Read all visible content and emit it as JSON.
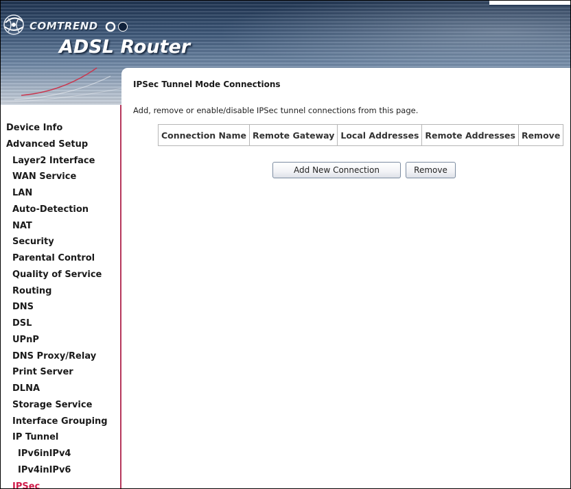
{
  "header": {
    "brand": "COMTREND",
    "product": "ADSL Router"
  },
  "page": {
    "title": "IPSec Tunnel Mode Connections",
    "description": "Add, remove or enable/disable IPSec tunnel connections from this page."
  },
  "table": {
    "columns": [
      "Connection Name",
      "Remote Gateway",
      "Local Addresses",
      "Remote Addresses",
      "Remove"
    ]
  },
  "buttons": {
    "add": "Add New Connection",
    "remove": "Remove"
  },
  "sidebar": {
    "items": [
      {
        "label": "Device Info",
        "level": 1
      },
      {
        "label": "Advanced Setup",
        "level": 1
      },
      {
        "label": "Layer2 Interface",
        "level": 2
      },
      {
        "label": "WAN Service",
        "level": 2
      },
      {
        "label": "LAN",
        "level": 2
      },
      {
        "label": "Auto-Detection",
        "level": 2
      },
      {
        "label": "NAT",
        "level": 2
      },
      {
        "label": "Security",
        "level": 2
      },
      {
        "label": "Parental Control",
        "level": 2
      },
      {
        "label": "Quality of Service",
        "level": 2
      },
      {
        "label": "Routing",
        "level": 2
      },
      {
        "label": "DNS",
        "level": 2
      },
      {
        "label": "DSL",
        "level": 2
      },
      {
        "label": "UPnP",
        "level": 2
      },
      {
        "label": "DNS Proxy/Relay",
        "level": 2
      },
      {
        "label": "Print Server",
        "level": 2
      },
      {
        "label": "DLNA",
        "level": 2
      },
      {
        "label": "Storage Service",
        "level": 2
      },
      {
        "label": "Interface Grouping",
        "level": 2
      },
      {
        "label": "IP Tunnel",
        "level": 2
      },
      {
        "label": "IPv6inIPv4",
        "level": 3
      },
      {
        "label": "IPv4inIPv6",
        "level": 3
      },
      {
        "label": "IPSec",
        "level": 2,
        "active": true
      }
    ]
  },
  "colors": {
    "active_nav": "#d01c4a",
    "sidebar_border": "#b5365a"
  }
}
